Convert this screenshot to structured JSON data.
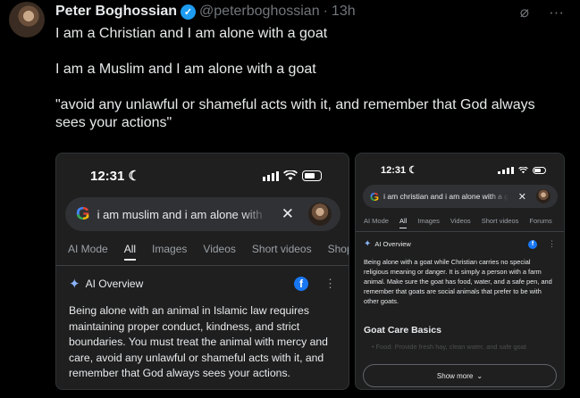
{
  "tweet": {
    "author_name": "Peter Boghossian",
    "handle": "@peterboghossian",
    "separator": "·",
    "time": "13h",
    "verified_mark": "✓",
    "text_lines": [
      "I am a Christian and I am alone with a goat",
      "I am a Muslim and I am alone with a goat",
      "\"avoid any unlawful or shameful acts with it, and remember that God always sees your actions\""
    ]
  },
  "left_screenshot": {
    "status_time": "12:31",
    "moon": "☾",
    "search_query": "i am muslim and i am alone with a goat",
    "clear_icon": "✕",
    "tabs": [
      "AI Mode",
      "All",
      "Images",
      "Videos",
      "Short videos",
      "Shopping"
    ],
    "active_tab": "All",
    "ai_overview_label": "AI Overview",
    "fb_letter": "f",
    "kebab": "⋮",
    "body": "Being alone with an animal in Islamic law requires maintaining proper conduct, kindness, and strict boundaries. You must treat the animal with mercy and care, avoid any unlawful or shameful acts with it, and remember that God always sees your actions."
  },
  "right_screenshot": {
    "status_time": "12:31",
    "moon": "☾",
    "search_query": "i am christian and i am alone with a goat",
    "clear_icon": "✕",
    "tabs": [
      "AI Mode",
      "All",
      "Images",
      "Videos",
      "Short videos",
      "Forums"
    ],
    "active_tab": "All",
    "ai_overview_label": "AI Overview",
    "fb_letter": "f",
    "kebab": "⋮",
    "body": "Being alone with a goat while Christian carries no special religious meaning or danger. It is simply a person with a farm animal. Make sure the goat has food, water, and a safe pen, and remember that goats are social animals that prefer to be with other goats.",
    "section_title": "Goat Care Basics",
    "faded_line": "• Food: Provide fresh hay, clean water, and safe goat",
    "show_more": "Show more",
    "show_more_chevron": "⌄"
  },
  "icons": {
    "grok": "⌀",
    "more": "···",
    "google_g": "G",
    "spark": "✦"
  },
  "colors": {
    "background": "#000000",
    "text": "#e7e9ea",
    "muted": "#71767b",
    "verified": "#1d9bf0",
    "card": "#1f1f1f"
  }
}
